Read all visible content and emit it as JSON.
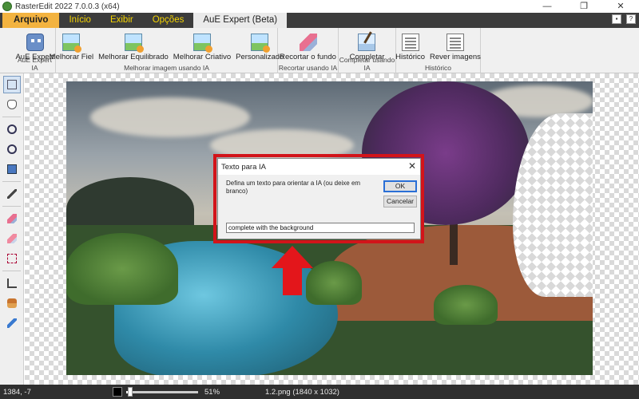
{
  "window": {
    "title": "RasterEdit 2022 7.0.0.3 (x64)",
    "minimize": "—",
    "restore": "❐",
    "close": "✕"
  },
  "tabs": [
    {
      "label": "Arquivo"
    },
    {
      "label": "Início"
    },
    {
      "label": "Exibir"
    },
    {
      "label": "Opções"
    },
    {
      "label": "AuE Expert (Beta)"
    }
  ],
  "ribbon": {
    "groups": [
      {
        "name": "AuE Expert IA",
        "buttons": [
          {
            "label": "AuE Expert",
            "icon": "robot-icon"
          }
        ]
      },
      {
        "name": "Melhorar imagem usando IA",
        "buttons": [
          {
            "label": "Melhorar Fiel",
            "icon": "image-enhance-icon"
          },
          {
            "label": "Melhorar Equilibrado",
            "icon": "image-enhance-icon"
          },
          {
            "label": "Melhorar Criativo",
            "icon": "image-enhance-icon"
          },
          {
            "label": "Personalizado",
            "icon": "image-settings-icon"
          }
        ]
      },
      {
        "name": "Recortar usando IA",
        "buttons": [
          {
            "label": "Recortar o fundo",
            "icon": "eraser-icon"
          }
        ]
      },
      {
        "name": "Completar usando IA",
        "buttons": [
          {
            "label": "Completar",
            "icon": "magic-wand-icon"
          }
        ]
      },
      {
        "name": "Histórico",
        "buttons": [
          {
            "label": "Histórico",
            "icon": "history-document-icon"
          },
          {
            "label": "Rever imagens",
            "icon": "review-document-icon"
          }
        ]
      }
    ]
  },
  "dialog": {
    "title": "Texto para IA",
    "message": "Defina um texto para orientar a IA (ou deixe em branco)",
    "ok": "OK",
    "cancel": "Cancelar",
    "input_value": "complete with the background",
    "close": "✕"
  },
  "status": {
    "coords": "1384, -7",
    "zoom_percent": "51%",
    "zoom_level": 0.51,
    "file": "1.2.png (1840 x 1032)"
  },
  "colors": {
    "tabbar": "#3c3c3c",
    "tab_text": "#f5d400",
    "file_tab": "#f3b340",
    "highlight": "#d2141a",
    "arrow": "#e3161b"
  }
}
